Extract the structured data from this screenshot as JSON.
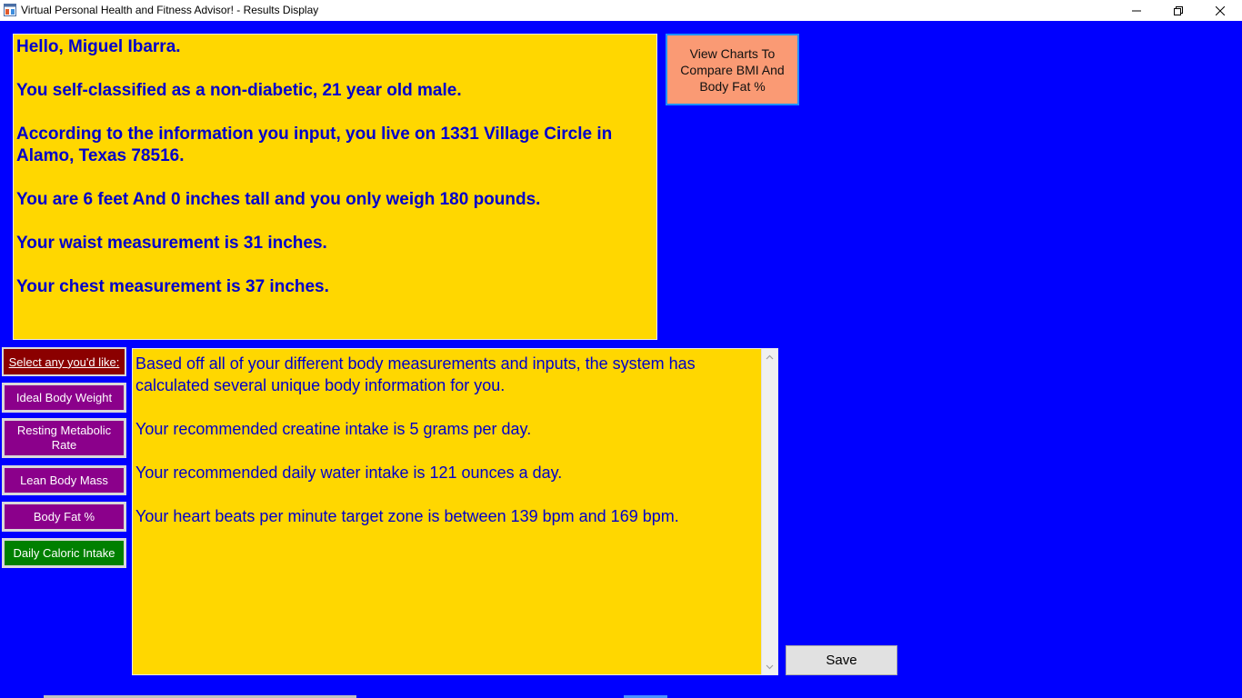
{
  "window": {
    "title": "Virtual Personal Health and Fitness Advisor! - Results Display",
    "icon": "app-window-icon",
    "controls": [
      "minimize-icon",
      "maximize-icon",
      "close-icon"
    ]
  },
  "info_panel": {
    "lines": [
      "Hello, Miguel Ibarra.",
      "You self-classified as a non-diabetic, 21 year old male.",
      "According to the information you input, you live on 1331 Village Circle in Alamo, Texas 78516.",
      "You are 6 feet And 0 inches tall and you only weigh 180 pounds.",
      "Your waist measurement is 31 inches.",
      "Your chest measurement is 37 inches."
    ]
  },
  "charts_button": {
    "label": "View Charts To Compare BMI And Body Fat %"
  },
  "sidebar": {
    "label": "Select any you'd like:",
    "buttons": [
      {
        "label": "Ideal Body Weight"
      },
      {
        "label": "Resting Metabolic Rate"
      },
      {
        "label": "Lean Body Mass"
      },
      {
        "label": "Body Fat %"
      },
      {
        "label": "Daily Caloric Intake"
      }
    ]
  },
  "results": {
    "paragraphs": [
      "Based off all of your different body measurements and inputs, the system has calculated several unique body information for you.",
      "Your recommended creatine intake is 5 grams per day.",
      "Your recommended daily water intake is 121 ounces a day.",
      "Your heart beats per minute target zone is between 139 bpm and 169 bpm."
    ]
  },
  "save_button": {
    "label": "Save"
  },
  "colors": {
    "background": "#0000ff",
    "panel": "#ffd700",
    "text": "#0000cc",
    "charts_button": "#fa9a74",
    "sidebar_label": "#8b0000",
    "sidebar_button": "#8b008b",
    "sidebar_button_active": "#008000"
  }
}
